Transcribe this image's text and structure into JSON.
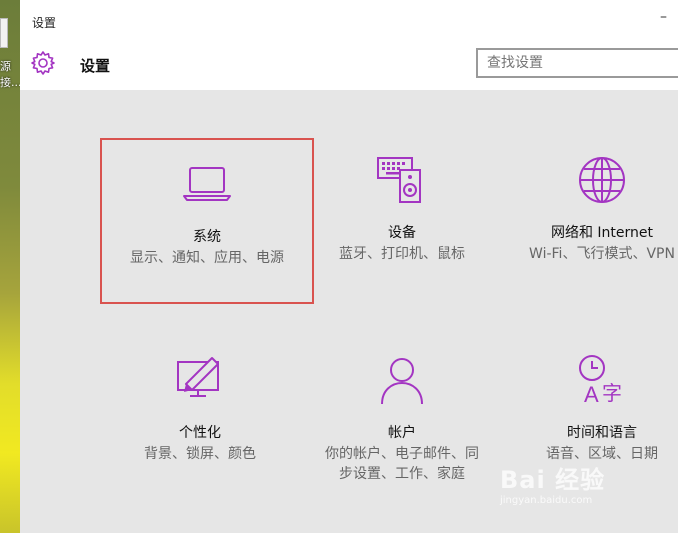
{
  "desktop": {
    "label_line1": "源",
    "label_line2": "接..."
  },
  "window": {
    "title": "设置",
    "minimize_glyph": "–"
  },
  "header": {
    "title": "设置",
    "search_placeholder": "查找设置"
  },
  "tiles": [
    {
      "title": "系统",
      "desc": "显示、通知、应用、电源",
      "icon": "laptop-icon"
    },
    {
      "title": "设备",
      "desc": "蓝牙、打印机、鼠标",
      "icon": "devices-icon"
    },
    {
      "title": "网络和 Internet",
      "desc": "Wi-Fi、飞行模式、VPN",
      "icon": "globe-icon"
    },
    {
      "title": "个性化",
      "desc": "背景、锁屏、颜色",
      "icon": "personalization-icon"
    },
    {
      "title": "帐户",
      "desc": "你的帐户、电子邮件、同步设置、工作、家庭",
      "icon": "person-icon"
    },
    {
      "title": "时间和语言",
      "desc": "语音、区域、日期",
      "icon": "time-language-icon"
    }
  ],
  "colors": {
    "accent": "#a335c2",
    "selection_border": "#d9534f"
  },
  "watermark": {
    "brand": "Bai 经验",
    "url": "jingyan.baidu.com"
  }
}
